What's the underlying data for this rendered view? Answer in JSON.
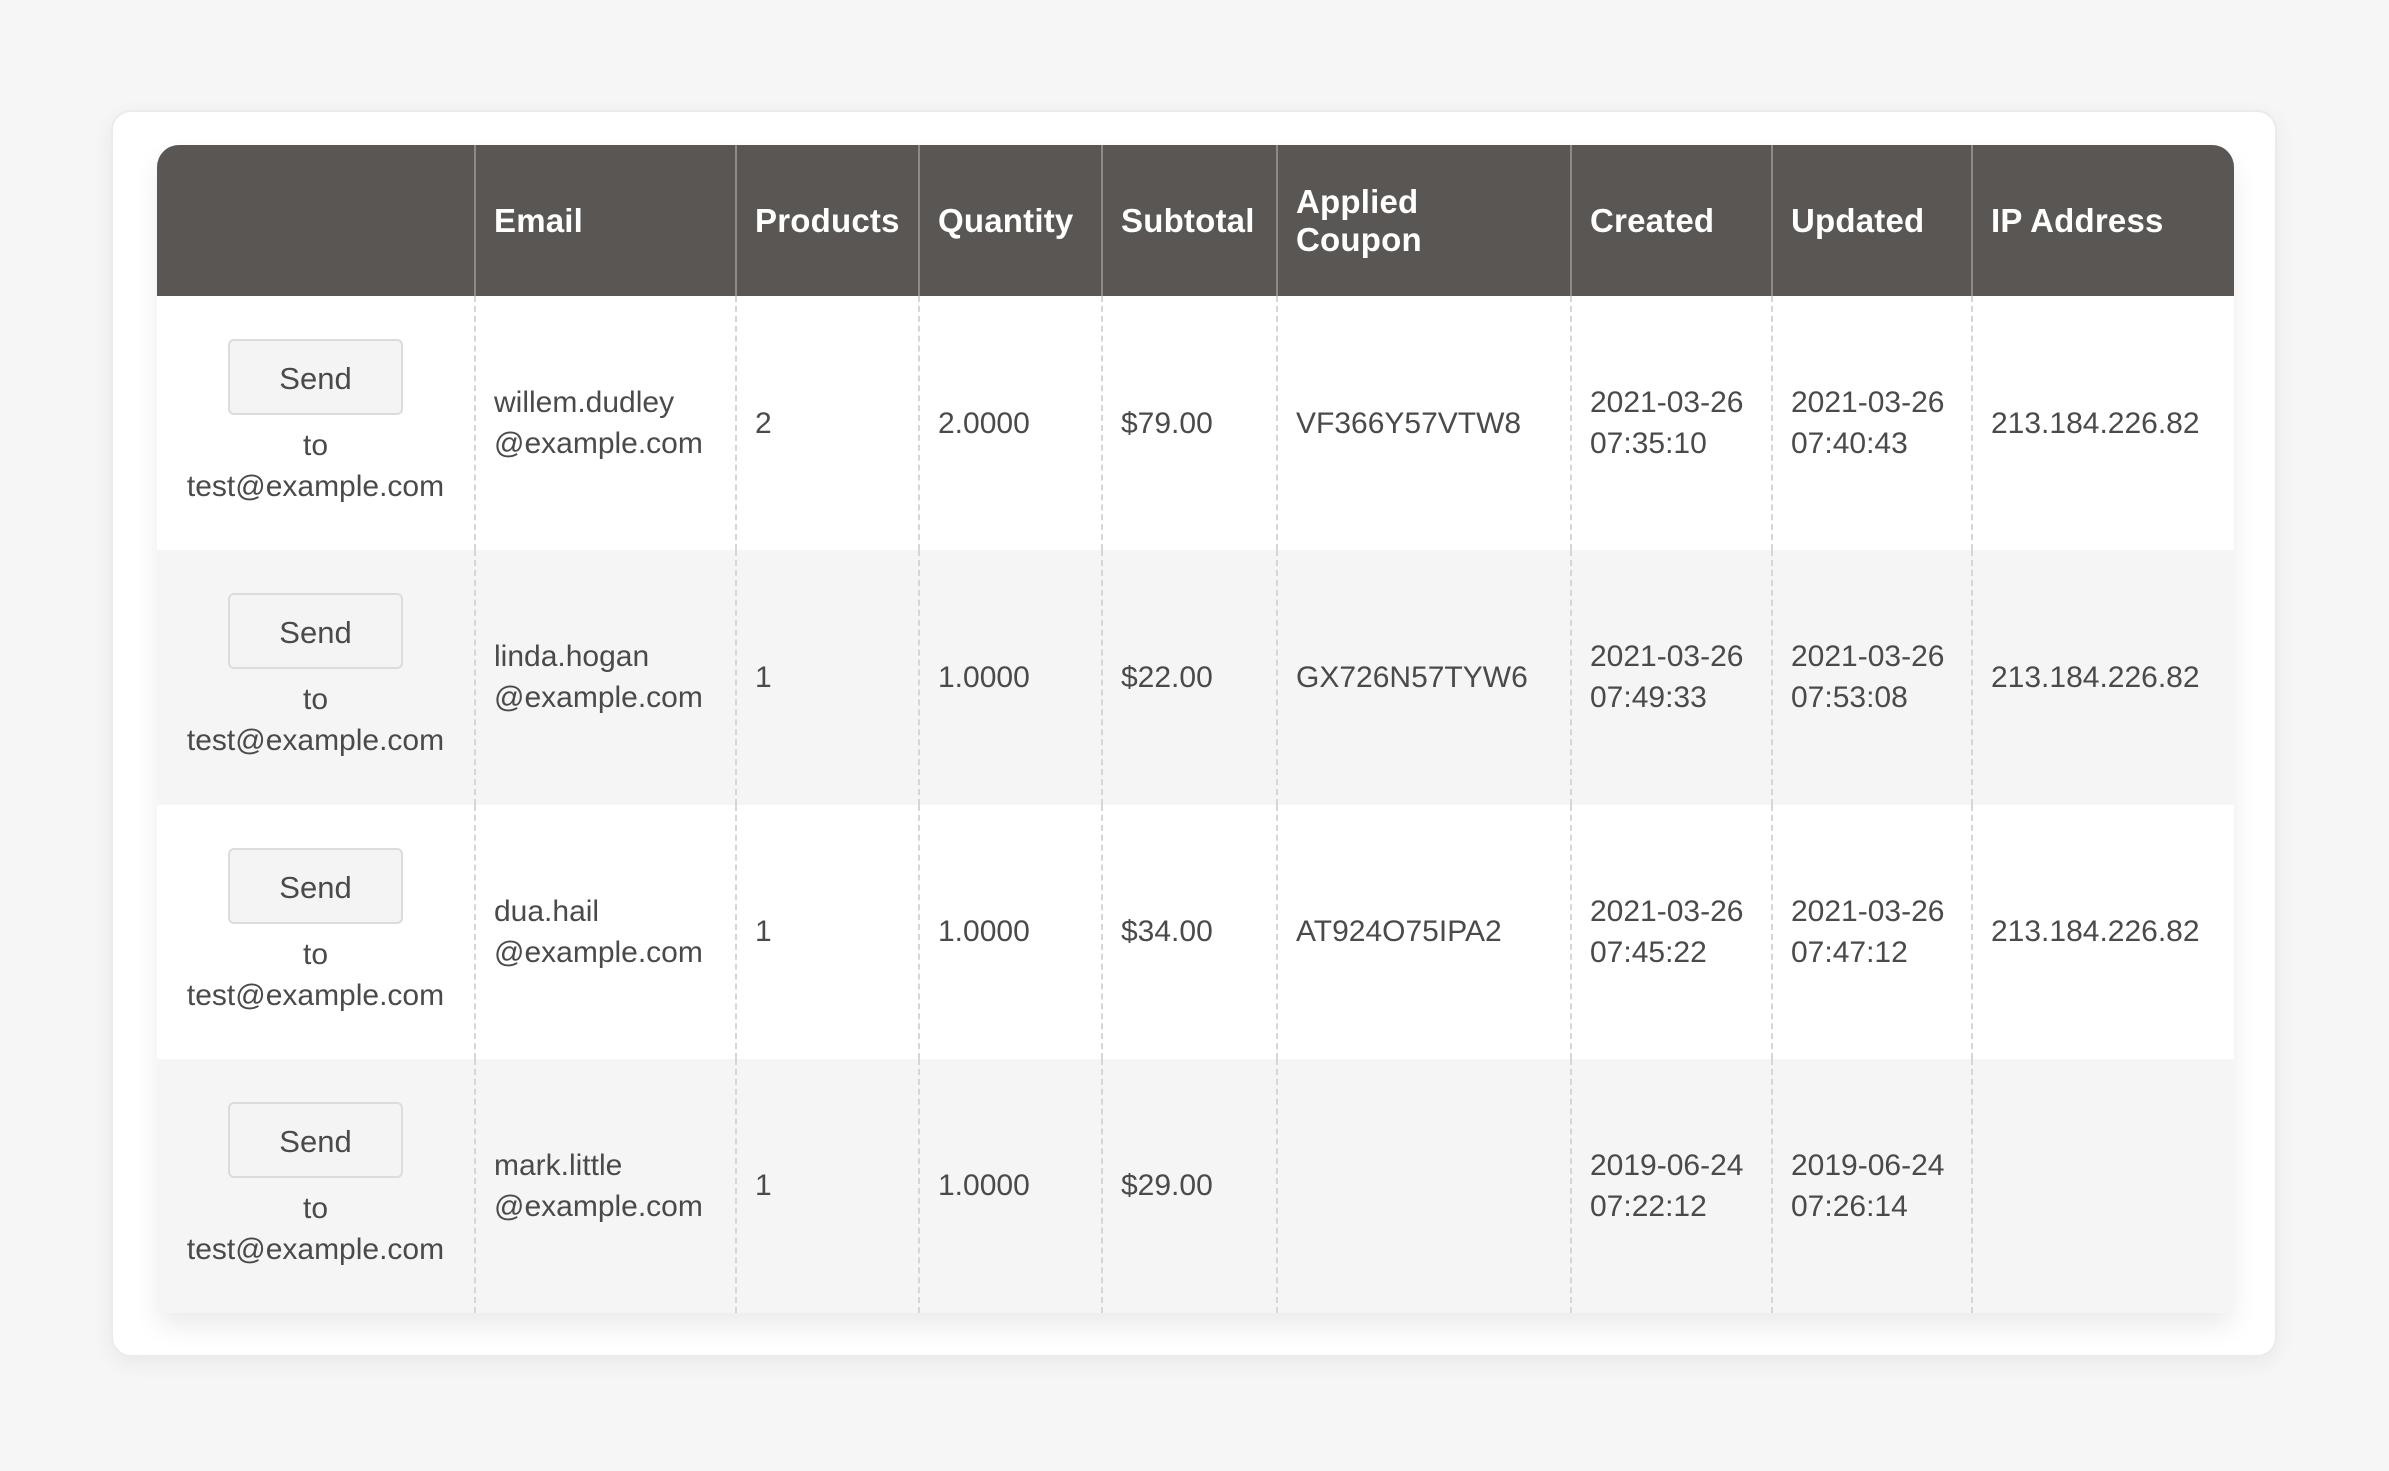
{
  "table": {
    "headers": [
      "",
      "Email",
      "Products",
      "Quantity",
      "Subtotal",
      "Applied Coupon",
      "Created",
      "Updated",
      "IP Address"
    ],
    "rows": [
      {
        "action": {
          "button_label": "Send",
          "to_label": "to",
          "target_email": "test@example.com"
        },
        "email": {
          "user": "willem.dudley",
          "domain": "@example.com"
        },
        "products": "2",
        "quantity": "2.0000",
        "subtotal": "$79.00",
        "coupon": "VF366Y57VTW8",
        "created": {
          "date": "2021-03-26",
          "time": "07:35:10"
        },
        "updated": {
          "date": "2021-03-26",
          "time": "07:40:43"
        },
        "ip": "213.184.226.82"
      },
      {
        "action": {
          "button_label": "Send",
          "to_label": "to",
          "target_email": "test@example.com"
        },
        "email": {
          "user": "linda.hogan",
          "domain": "@example.com"
        },
        "products": "1",
        "quantity": "1.0000",
        "subtotal": "$22.00",
        "coupon": "GX726N57TYW6",
        "created": {
          "date": "2021-03-26",
          "time": "07:49:33"
        },
        "updated": {
          "date": "2021-03-26",
          "time": "07:53:08"
        },
        "ip": "213.184.226.82"
      },
      {
        "action": {
          "button_label": "Send",
          "to_label": "to",
          "target_email": "test@example.com"
        },
        "email": {
          "user": "dua.hail",
          "domain": "@example.com"
        },
        "products": "1",
        "quantity": "1.0000",
        "subtotal": "$34.00",
        "coupon": "AT924O75IPA2",
        "created": {
          "date": "2021-03-26",
          "time": "07:45:22"
        },
        "updated": {
          "date": "2021-03-26",
          "time": "07:47:12"
        },
        "ip": "213.184.226.82"
      },
      {
        "action": {
          "button_label": "Send",
          "to_label": "to",
          "target_email": "test@example.com"
        },
        "email": {
          "user": "mark.little",
          "domain": "@example.com"
        },
        "products": "1",
        "quantity": "1.0000",
        "subtotal": "$29.00",
        "coupon": "",
        "created": {
          "date": "2019-06-24",
          "time": "07:22:12"
        },
        "updated": {
          "date": "2019-06-24",
          "time": "07:26:14"
        },
        "ip": ""
      }
    ]
  },
  "colors": {
    "header_bg": "#5a5653",
    "header_text": "#ffffff",
    "row_alt_bg": "#f5f5f5",
    "text": "#4a4a4a"
  }
}
